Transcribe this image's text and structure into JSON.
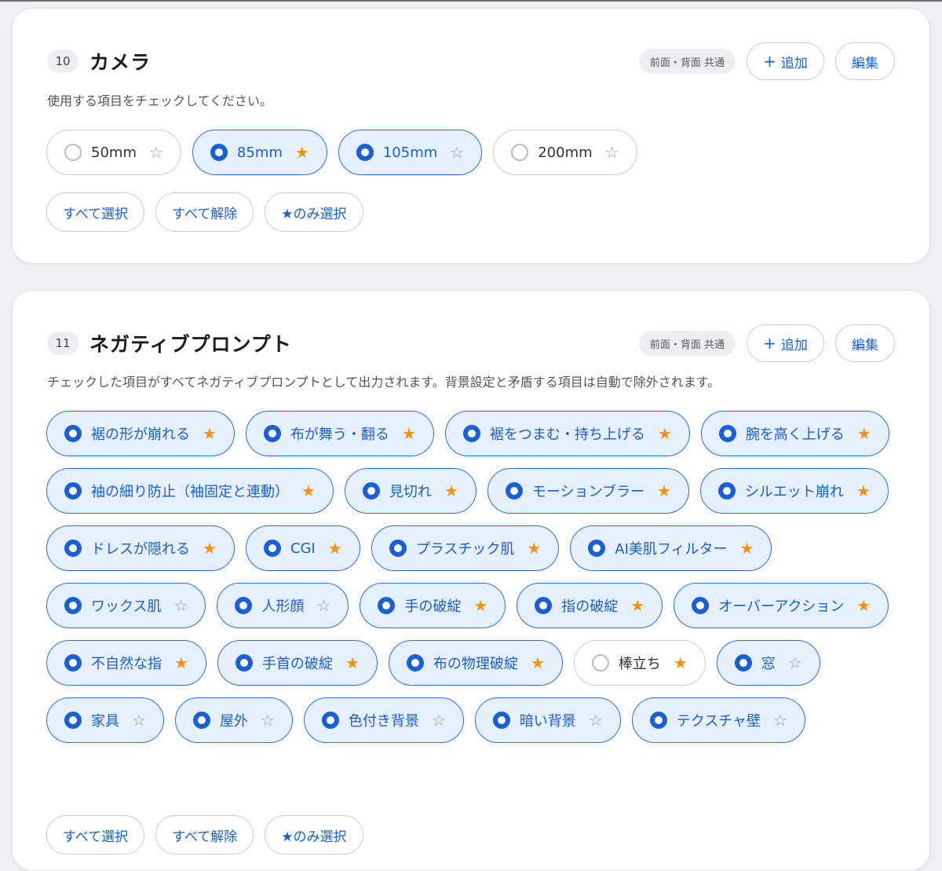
{
  "camera": {
    "number": "10",
    "title": "カメラ",
    "tag": "前面・背面 共通",
    "add_label": "追加",
    "add_icon": "+",
    "edit_label": "編集",
    "description": "使用する項目をチェックしてください。",
    "options": [
      {
        "label": "50mm",
        "checked": false,
        "star": "☆"
      },
      {
        "label": "85mm",
        "checked": true,
        "star": "★"
      },
      {
        "label": "105mm",
        "checked": true,
        "star": "☆"
      },
      {
        "label": "200mm",
        "checked": false,
        "star": "☆"
      }
    ],
    "actions": {
      "select_all": "すべて選択",
      "clear_all": "すべて解除",
      "star_only": "★のみ選択"
    }
  },
  "negative": {
    "number": "11",
    "title": "ネガティブプロンプト",
    "tag": "前面・背面 共通",
    "add_label": "追加",
    "add_icon": "+",
    "edit_label": "編集",
    "description": "チェックした項目がすべてネガティブプロンプトとして出力されます。背景設定と矛盾する項目は自動で除外されます。",
    "options": [
      {
        "label": "裾の形が崩れる",
        "checked": true,
        "star": "★"
      },
      {
        "label": "布が舞う・翻る",
        "checked": true,
        "star": "★"
      },
      {
        "label": "裾をつまむ・持ち上げる",
        "checked": true,
        "star": "★"
      },
      {
        "label": "腕を高く上げる",
        "checked": true,
        "star": "★"
      },
      {
        "label": "袖の細り防止（袖固定と連動）",
        "checked": true,
        "star": "★"
      },
      {
        "label": "見切れ",
        "checked": true,
        "star": "★"
      },
      {
        "label": "モーションブラー",
        "checked": true,
        "star": "★"
      },
      {
        "label": "シルエット崩れ",
        "checked": true,
        "star": "★"
      },
      {
        "label": "ドレスが隠れる",
        "checked": true,
        "star": "★"
      },
      {
        "label": "CGI",
        "checked": true,
        "star": "★"
      },
      {
        "label": "プラスチック肌",
        "checked": true,
        "star": "★"
      },
      {
        "label": "AI美肌フィルター",
        "checked": true,
        "star": "★"
      },
      {
        "label": "ワックス肌",
        "checked": true,
        "star": "☆"
      },
      {
        "label": "人形顔",
        "checked": true,
        "star": "☆"
      },
      {
        "label": "手の破綻",
        "checked": true,
        "star": "★"
      },
      {
        "label": "指の破綻",
        "checked": true,
        "star": "★"
      },
      {
        "label": "オーバーアクション",
        "checked": true,
        "star": "★"
      },
      {
        "label": "不自然な指",
        "checked": true,
        "star": "★"
      },
      {
        "label": "手首の破綻",
        "checked": true,
        "star": "★"
      },
      {
        "label": "布の物理破綻",
        "checked": true,
        "star": "★"
      },
      {
        "label": "棒立ち",
        "checked": false,
        "star": "★"
      },
      {
        "label": "窓",
        "checked": true,
        "star": "☆"
      },
      {
        "label": "家具",
        "checked": true,
        "star": "☆"
      },
      {
        "label": "屋外",
        "checked": true,
        "star": "☆"
      },
      {
        "label": "色付き背景",
        "checked": true,
        "star": "☆"
      },
      {
        "label": "暗い背景",
        "checked": true,
        "star": "☆"
      },
      {
        "label": "テクスチャ壁",
        "checked": true,
        "star": "☆"
      }
    ],
    "actions": {
      "select_all": "すべて選択",
      "clear_all": "すべて解除",
      "star_only": "★のみ選択"
    }
  },
  "colors": {
    "accent": "#1b5fd6",
    "chip_selected_bg": "#e6effc",
    "star_filled": "#f0920f",
    "star_empty": "#9a9ca3",
    "page_bg": "#efeff4"
  }
}
